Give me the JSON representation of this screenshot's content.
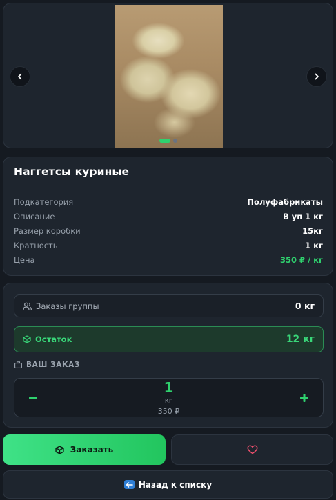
{
  "gallery": {
    "image_alt": "Наггетсы куриные",
    "dots": 2,
    "active_dot": 0
  },
  "product": {
    "title": "Наггетсы куриные",
    "details": [
      {
        "label": "Подкатегория",
        "value": "Полуфабрикаты",
        "accent": false
      },
      {
        "label": "Описание",
        "value": "В уп 1 кг",
        "accent": false
      },
      {
        "label": "Размер коробки",
        "value": "15кг",
        "accent": false
      },
      {
        "label": "Кратность",
        "value": "1 кг",
        "accent": false
      },
      {
        "label": "Цена",
        "value": "350 ₽ / кг",
        "accent": true
      }
    ]
  },
  "order": {
    "group_orders_label": "Заказы группы",
    "group_orders_value": "0 кг",
    "stock_label": "Остаток",
    "stock_value": "12 кг",
    "your_order_label": "ВАШ ЗАКАЗ",
    "quantity": "1",
    "unit": "кг",
    "total": "350 ₽",
    "minus_label": "−",
    "plus_label": "+"
  },
  "actions": {
    "order_label": "Заказать",
    "back_label": "Назад к списку"
  },
  "colors": {
    "accent": "#2fd16e",
    "background": "#151a21",
    "card": "#1e252e",
    "favorite": "#f0506e"
  },
  "icons": {
    "prev": "chevron-left-icon",
    "next": "chevron-right-icon",
    "group": "users-icon",
    "stock": "box-icon",
    "your_order": "briefcase-icon",
    "order_button": "box-icon",
    "favorite": "heart-icon",
    "back": "arrow-left-icon"
  }
}
